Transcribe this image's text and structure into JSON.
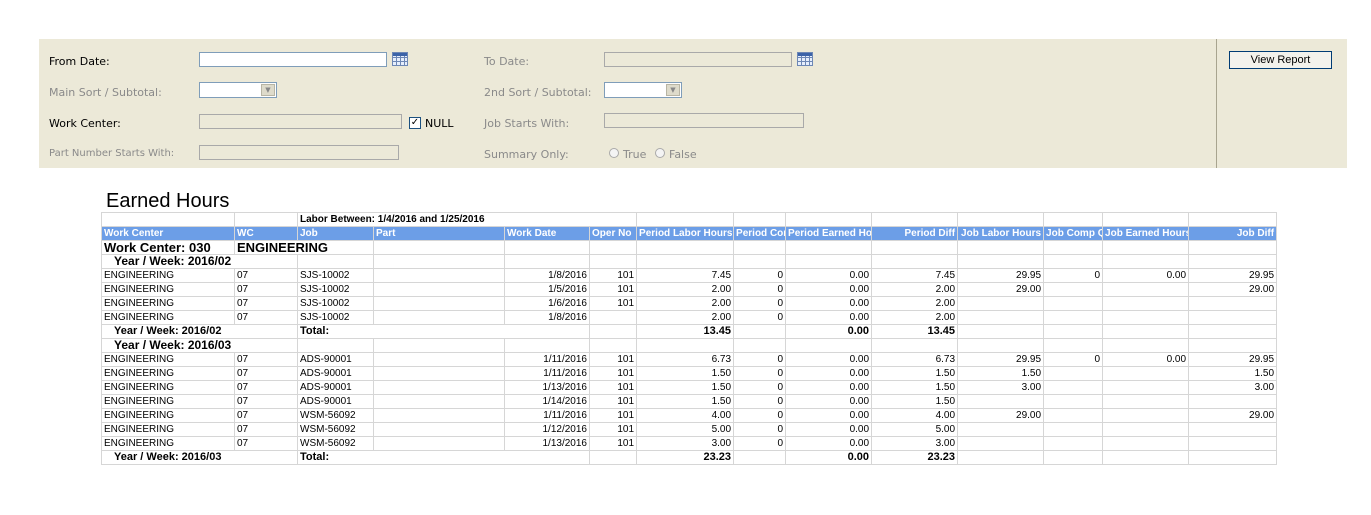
{
  "form": {
    "from_date_label": "From Date:",
    "to_date_label": "To Date:",
    "main_sort_label": "Main Sort / Subtotal:",
    "second_sort_label": "2nd Sort / Subtotal:",
    "work_center_label": "Work Center:",
    "null_label": "NULL",
    "null_checked": "✓",
    "job_starts_label": "Job Starts With:",
    "part_number_label": "Part Number Starts With:",
    "summary_only_label": "Summary Only:",
    "summary_true": "True",
    "summary_false": "False",
    "view_report": "View Report"
  },
  "report": {
    "title": "Earned Hours",
    "labor_between": "Labor Between: 1/4/2016 and 1/25/2016",
    "columns": [
      "Work Center",
      "WC",
      "Job",
      "Part",
      "Work Date",
      "Oper No",
      "Period Labor Hours",
      "Period Comp Qty",
      "Period Earned Hours",
      "Period Diff",
      "Job Labor Hours",
      "Job Comp Qty",
      "Job Earned Hours",
      "Job Diff"
    ],
    "work_center_header": "Work Center: 030",
    "work_center_name": "ENGINEERING",
    "groups": [
      {
        "week": "Year / Week: 2016/02",
        "rows": [
          [
            "ENGINEERING",
            "07",
            "SJS-10002",
            "",
            "1/8/2016",
            "101",
            "7.45",
            "0",
            "0.00",
            "7.45",
            "29.95",
            "0",
            "0.00",
            "29.95"
          ],
          [
            "ENGINEERING",
            "07",
            "SJS-10002",
            "",
            "1/5/2016",
            "101",
            "2.00",
            "0",
            "0.00",
            "2.00",
            "29.00",
            "",
            "",
            "29.00"
          ],
          [
            "ENGINEERING",
            "07",
            "SJS-10002",
            "",
            "1/6/2016",
            "101",
            "2.00",
            "0",
            "0.00",
            "2.00",
            "",
            "",
            "",
            ""
          ],
          [
            "ENGINEERING",
            "07",
            "SJS-10002",
            "",
            "1/8/2016",
            "",
            "2.00",
            "0",
            "0.00",
            "2.00",
            "",
            "",
            "",
            ""
          ]
        ],
        "total_week": "Year / Week: 2016/02",
        "total_label": "Total:",
        "total_labor": "13.45",
        "total_earned": "0.00",
        "total_diff": "13.45"
      },
      {
        "week": "Year / Week: 2016/03",
        "rows": [
          [
            "ENGINEERING",
            "07",
            "ADS-90001",
            "",
            "1/11/2016",
            "101",
            "6.73",
            "0",
            "0.00",
            "6.73",
            "29.95",
            "0",
            "0.00",
            "29.95"
          ],
          [
            "ENGINEERING",
            "07",
            "ADS-90001",
            "",
            "1/11/2016",
            "101",
            "1.50",
            "0",
            "0.00",
            "1.50",
            "1.50",
            "",
            "",
            "1.50"
          ],
          [
            "ENGINEERING",
            "07",
            "ADS-90001",
            "",
            "1/13/2016",
            "101",
            "1.50",
            "0",
            "0.00",
            "1.50",
            "3.00",
            "",
            "",
            "3.00"
          ],
          [
            "ENGINEERING",
            "07",
            "ADS-90001",
            "",
            "1/14/2016",
            "101",
            "1.50",
            "0",
            "0.00",
            "1.50",
            "",
            "",
            "",
            ""
          ],
          [
            "ENGINEERING",
            "07",
            "WSM-56092",
            "",
            "1/11/2016",
            "101",
            "4.00",
            "0",
            "0.00",
            "4.00",
            "29.00",
            "",
            "",
            "29.00"
          ],
          [
            "ENGINEERING",
            "07",
            "WSM-56092",
            "",
            "1/12/2016",
            "101",
            "5.00",
            "0",
            "0.00",
            "5.00",
            "",
            "",
            "",
            ""
          ],
          [
            "ENGINEERING",
            "07",
            "WSM-56092",
            "",
            "1/13/2016",
            "101",
            "3.00",
            "0",
            "0.00",
            "3.00",
            "",
            "",
            "",
            ""
          ]
        ],
        "total_week": "Year / Week: 2016/03",
        "total_label": "Total:",
        "total_labor": "23.23",
        "total_earned": "0.00",
        "total_diff": "23.23"
      }
    ]
  },
  "colors": {
    "panel_bg": "#ece9d8",
    "header_bg": "#6c9ee7",
    "header_text": "#ffffff"
  }
}
